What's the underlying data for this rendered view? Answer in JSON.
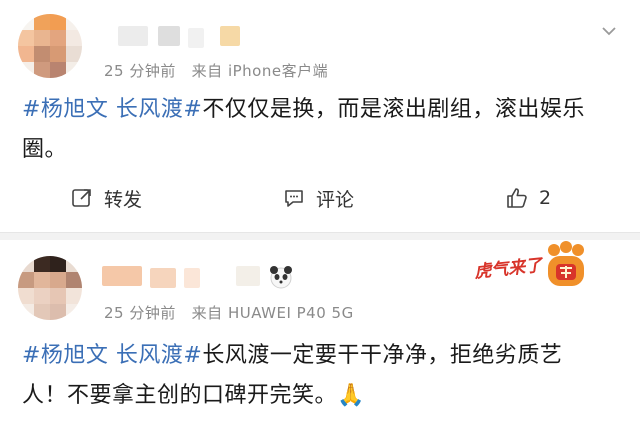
{
  "posts": [
    {
      "time": "25 分钟前",
      "source": "来自 iPhone客户端",
      "hashtag": "#杨旭文 长风渡#",
      "text_line1": "不仅仅是换，而是滚出剧组，滚出娱乐",
      "text_line2": "圈。",
      "actions": {
        "repost": "转发",
        "comment": "评论",
        "like_count": "2"
      }
    },
    {
      "time": "25 分钟前",
      "source": "来自 HUAWEI P40 5G",
      "hashtag": "#杨旭文 长风渡#",
      "text_line1": "长风渡一定要干干净净，拒绝劣质艺",
      "text_line2": "人！不要拿主创的口碑开完笑。",
      "emoji": "🙏"
    }
  ],
  "badge": {
    "text": "虎气来了"
  },
  "icons": [
    "chevron-down-icon",
    "repost-icon",
    "comment-icon",
    "like-icon",
    "panda-icon",
    "tiger-paw-icon"
  ],
  "colors": {
    "hashtag": "#3b6fb6",
    "meta": "#8a8a8a",
    "accent_orange": "#f0902a",
    "badge_red": "#d8342a"
  }
}
